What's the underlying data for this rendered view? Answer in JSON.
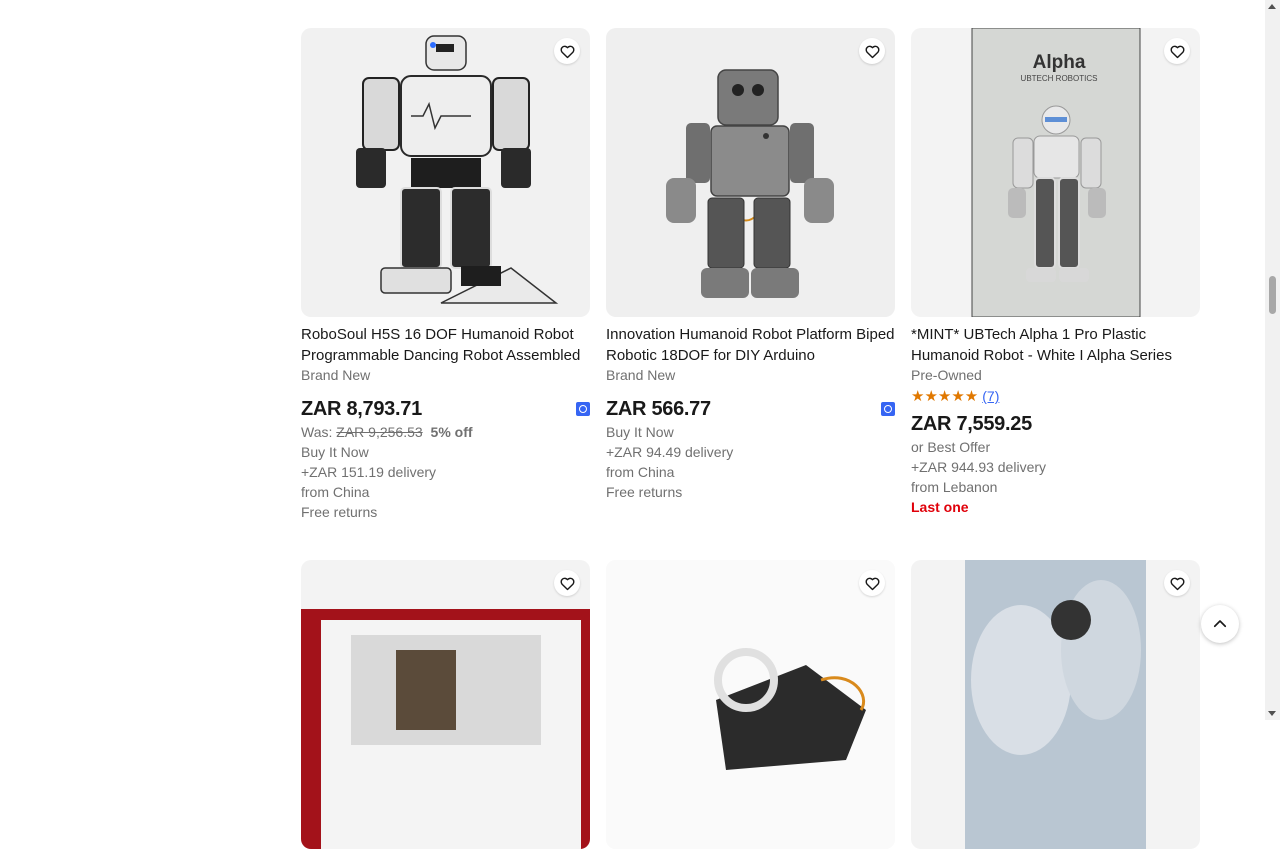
{
  "listings": [
    {
      "title": "RoboSoul H5S 16 DOF Humanoid Robot Programmable Dancing Robot Assembled",
      "condition": "Brand New",
      "price": "ZAR 8,793.71",
      "was_label": "Was:",
      "was_price": "ZAR 9,256.53",
      "discount": "5% off",
      "buy_format": "Buy It Now",
      "delivery": "+ZAR 151.19 delivery",
      "location": "from China",
      "returns": "Free returns",
      "image_icon": "humanoid-robot-white-photo"
    },
    {
      "title": "Innovation Humanoid Robot Platform Biped Robotic 18DOF for DIY Arduino",
      "condition": "Brand New",
      "price": "ZAR 566.77",
      "buy_format": "Buy It Now",
      "delivery": "+ZAR 94.49 delivery",
      "location": "from China",
      "returns": "Free returns",
      "image_icon": "humanoid-robot-grey-photo"
    },
    {
      "title": "*MINT* UBTech Alpha 1 Pro Plastic Humanoid Robot - White I Alpha Series",
      "condition": "Pre-Owned",
      "stars": "★★★★★",
      "rating_count": "(7)",
      "price": "ZAR 7,559.25",
      "buy_format": "or Best Offer",
      "delivery": "+ZAR 944.93 delivery",
      "location": "from Lebanon",
      "urgency": "Last one",
      "image_icon": "alpha-robot-box-photo",
      "box_brand": "Alpha",
      "box_sub": "UBTECH ROBOTICS"
    }
  ],
  "colors": {
    "link": "#3665f3",
    "star": "#e07800",
    "urgent": "#e0000a",
    "muted": "#707070"
  }
}
